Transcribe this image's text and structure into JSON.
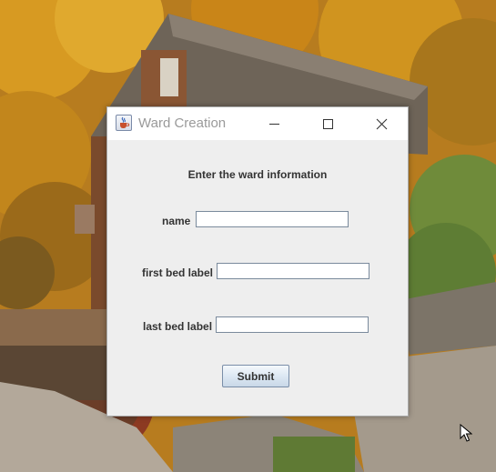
{
  "window": {
    "title": "Ward Creation",
    "icon": "java-cup-icon",
    "controls": [
      "minimize-icon",
      "maximize-icon",
      "close-icon"
    ]
  },
  "form": {
    "heading": "Enter the ward information",
    "name_label": "name",
    "name_value": "",
    "first_bed_label": "first bed label",
    "first_bed_value": "",
    "last_bed_label": "last bed label",
    "last_bed_value": "",
    "submit_label": "Submit"
  },
  "colors": {
    "window_bg": "#eeeeee",
    "titlebar_bg": "#ffffff",
    "title_text": "#9a9a9a",
    "label_text": "#333333",
    "field_border": "#7a8a9c",
    "button_border": "#7a8ea8"
  },
  "desktop": {
    "wallpaper": "autumn grist mill photo"
  }
}
